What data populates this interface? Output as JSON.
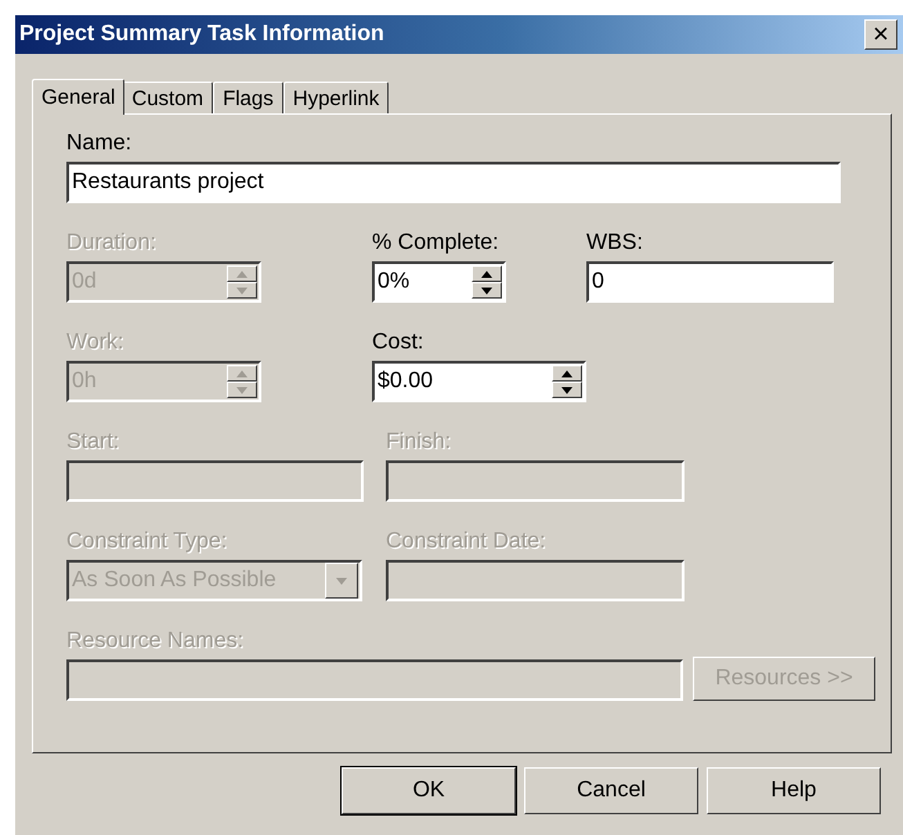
{
  "window": {
    "title": "Project Summary Task Information",
    "close": "×"
  },
  "tabs": [
    {
      "label": "General",
      "selected": true
    },
    {
      "label": "Custom",
      "selected": false
    },
    {
      "label": "Flags",
      "selected": false
    },
    {
      "label": "Hyperlink",
      "selected": false
    }
  ],
  "rows": [
    [
      {
        "kind": "text",
        "label": "Name:",
        "value": "Restaurants project",
        "disabled": false
      }
    ],
    [
      {
        "kind": "spin",
        "label": "Duration:",
        "value": "0d",
        "disabled": true
      },
      {
        "kind": "spin",
        "label": "% Complete:",
        "value": "0%",
        "disabled": false
      },
      {
        "kind": "text",
        "label": "WBS:",
        "value": "0",
        "disabled": false
      }
    ],
    [
      {
        "kind": "spin",
        "label": "Work:",
        "value": "0h",
        "disabled": true
      },
      {
        "kind": "spin",
        "label": "Cost:",
        "value": "$0.00",
        "disabled": false
      }
    ],
    [
      {
        "kind": "text",
        "label": "Start:",
        "disabled": true
      },
      {
        "kind": "text",
        "label": "Finish:",
        "disabled": true
      }
    ],
    [
      {
        "kind": "combo",
        "label": "Constraint Type:",
        "value": "As Soon As Possible",
        "disabled": true
      },
      {
        "kind": "text",
        "label": "Constraint Date:",
        "disabled": true
      }
    ],
    [
      {
        "kind": "text",
        "label": "Resource Names:",
        "disabled": true
      },
      {
        "kind": "button",
        "value": "Resources >>",
        "disabled": true
      }
    ]
  ],
  "buttons": [
    {
      "label": "OK",
      "default": true
    },
    {
      "label": "Cancel",
      "default": false
    },
    {
      "label": "Help",
      "default": false
    }
  ]
}
